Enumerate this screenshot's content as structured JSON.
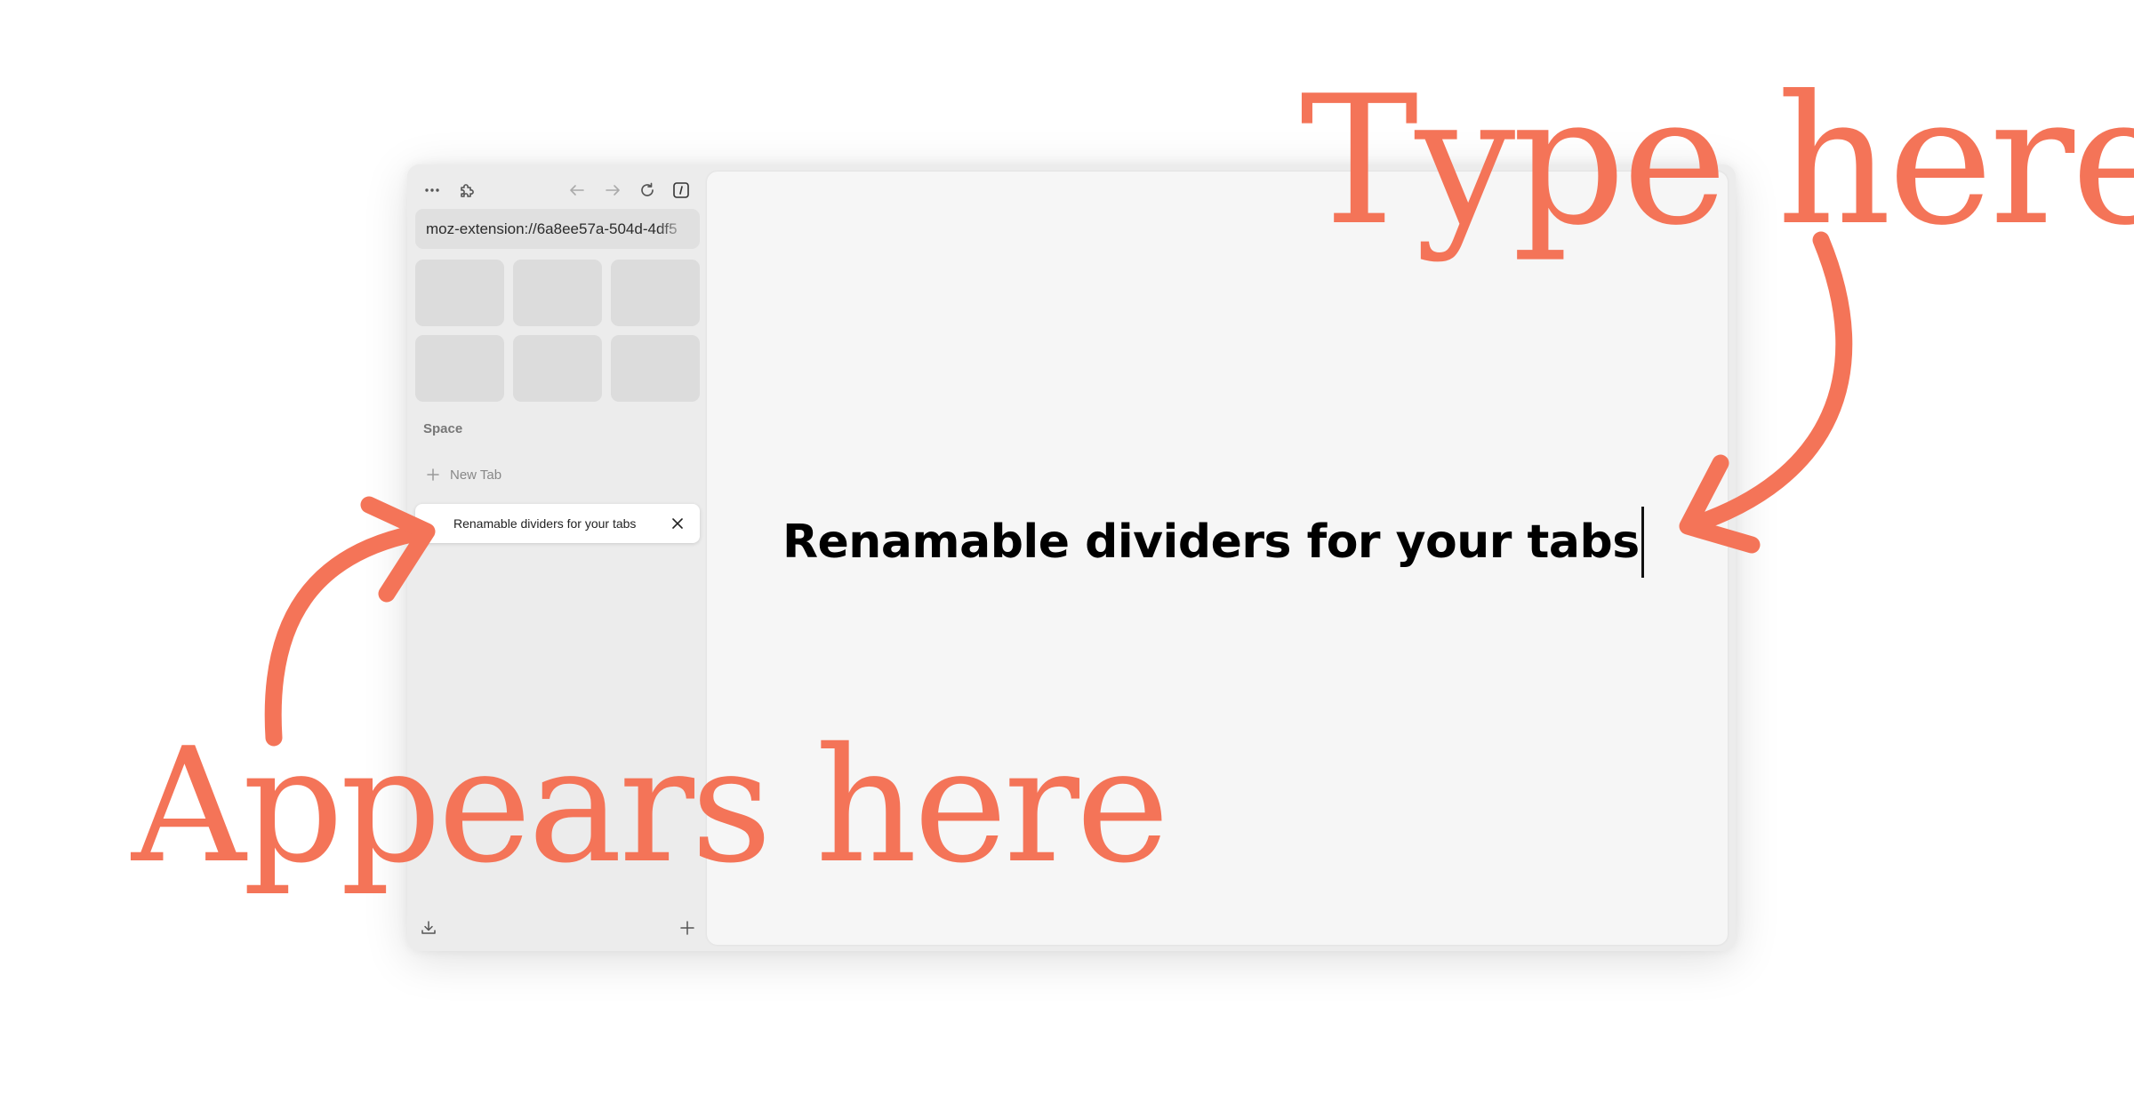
{
  "annotations": {
    "type_here": "Type here",
    "appears_here": "Appears here"
  },
  "browser": {
    "url": "moz-extension://6a8ee57a-504d-4df5",
    "space_label": "Space",
    "new_tab_label": "New Tab",
    "divider_tab_label": "Renamable dividers for your tabs",
    "icons": {
      "menu": "more-horizontal-icon",
      "extensions": "puzzle-icon",
      "back": "arrow-left-icon",
      "forward": "arrow-right-icon",
      "reload": "reload-icon",
      "sidebar": "sidebar-toggle-icon",
      "new_tab": "plus-icon",
      "close_tab": "close-icon",
      "downloads": "download-icon",
      "add": "plus-icon"
    }
  },
  "content": {
    "divider_input_value": "Renamable dividers for your tabs"
  },
  "colors": {
    "accent": "#f47458",
    "sidebar_bg": "#ececec",
    "content_bg": "#f6f6f6"
  }
}
